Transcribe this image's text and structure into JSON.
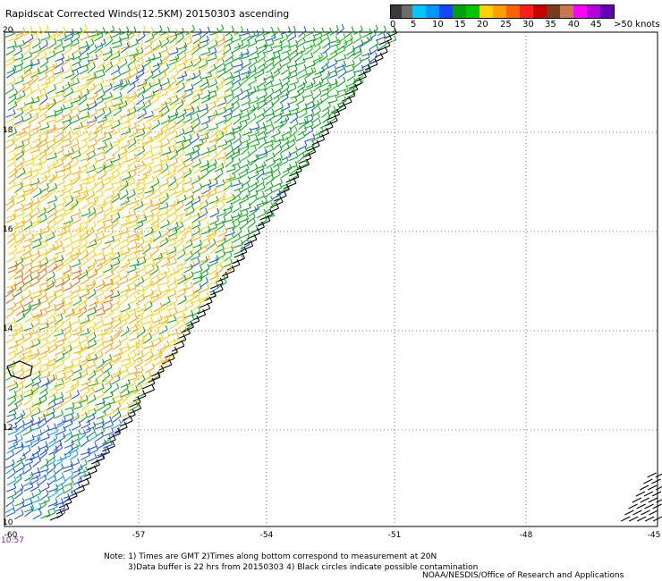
{
  "title": "Rapidscat Corrected Winds(12.5KM) 20150303 ascending",
  "colorbar": {
    "colors": [
      "#3a3a3a",
      "#6c6c6c",
      "#00c8ff",
      "#0096ff",
      "#1446ff",
      "#00a014",
      "#00c800",
      "#ffd200",
      "#ffa000",
      "#ff6400",
      "#ff1e1e",
      "#c80000",
      "#783c1e",
      "#c87850",
      "#ff00ff",
      "#b400dc",
      "#6400b4"
    ],
    "labels": [
      "0",
      "5",
      "10",
      "15",
      "20",
      "25",
      "30",
      "35",
      "40",
      "45",
      ">50 knots"
    ]
  },
  "y_labels": [
    "20",
    "18",
    "16",
    "14",
    "12",
    "10"
  ],
  "x_labels": [
    "-60",
    "-57",
    "-54",
    "-51",
    "-48",
    "-45"
  ],
  "time_label": "10:57",
  "notes": [
    "Note: 1) Times are GMT 2)Times along bottom correspond to measurement at 20N",
    "3)Data buffer is 22 hrs from 20150303 4) Black circles indicate possible contamination"
  ],
  "credit": "NOAA/NESDIS/Office of Research and Applications"
}
